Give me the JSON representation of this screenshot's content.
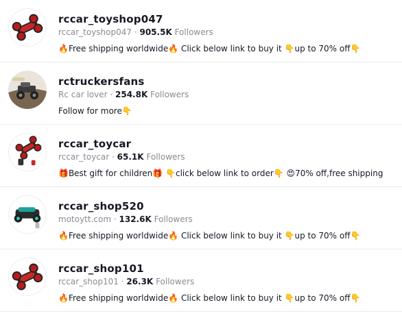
{
  "accounts": [
    {
      "username": "rccar_toyshop047",
      "nickname": "rccar_toyshop047",
      "followers": "905.5K",
      "followers_label": "Followers",
      "bio": "🔥Free shipping worldwide🔥 Click below link to buy it 👇up to 70% off👇",
      "avatar_icon": "red-rc-stunt-car-icon"
    },
    {
      "username": "rctruckersfans",
      "nickname": "Rc car lover",
      "followers": "254.8K",
      "followers_label": "Followers",
      "bio": "Follow for more👇",
      "avatar_icon": "rc-truck-photo-icon"
    },
    {
      "username": "rccar_toycar",
      "nickname": "rccar_toycar",
      "followers": "65.1K",
      "followers_label": "Followers",
      "bio": "🎁Best gift for children🎁 👇click below link to order👇 😍70% off,free shipping",
      "avatar_icon": "red-rc-stunt-car-with-remote-icon"
    },
    {
      "username": "rccar_shop520",
      "nickname": "motoytt.com",
      "followers": "132.6K",
      "followers_label": "Followers",
      "bio": "🔥Free shipping worldwide🔥 Click below link to buy it 👇up to 70% off👇",
      "avatar_icon": "teal-rc-car-icon"
    },
    {
      "username": "rccar_shop101",
      "nickname": "rccar_shop101",
      "followers": "26.3K",
      "followers_label": "Followers",
      "bio": "🔥Free shipping worldwide🔥 Click below link to buy it 👇up to 70% off👇",
      "avatar_icon": "red-rc-stunt-car-icon"
    }
  ]
}
